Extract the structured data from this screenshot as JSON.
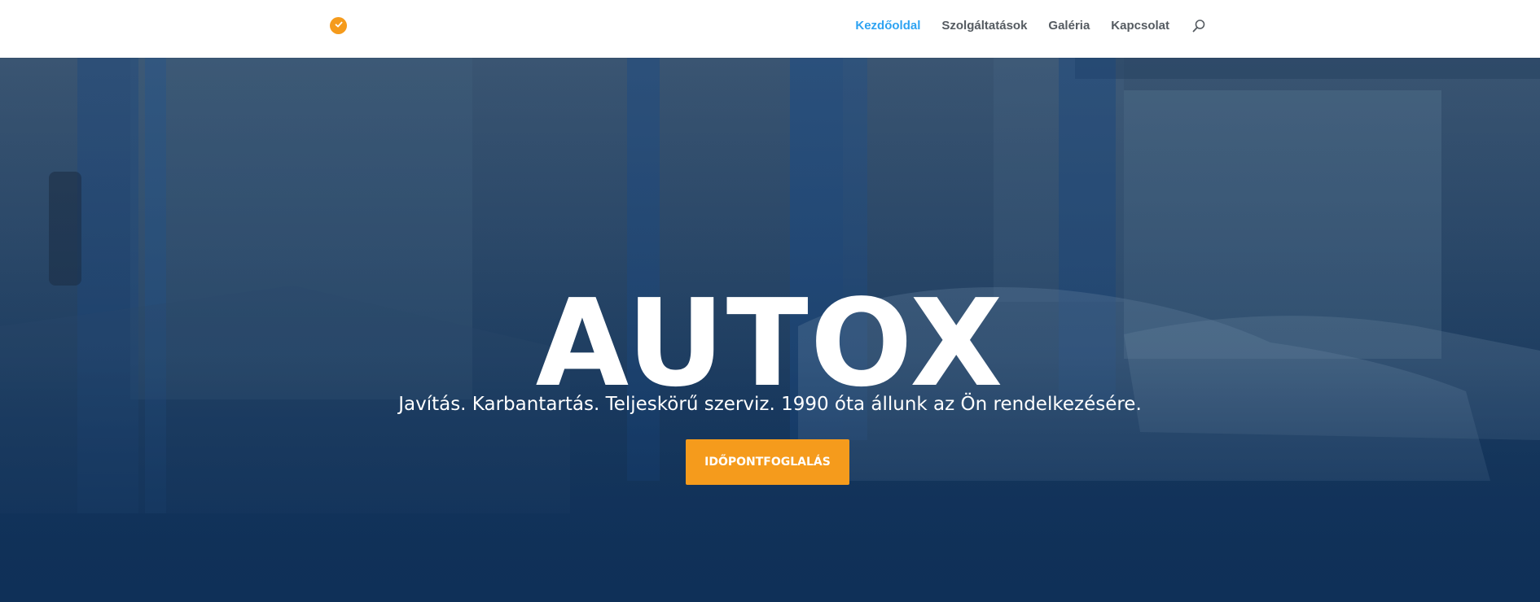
{
  "header": {
    "nav": [
      {
        "label": "Kezdőoldal",
        "active": true
      },
      {
        "label": "Szolgáltatások",
        "active": false
      },
      {
        "label": "Galéria",
        "active": false
      },
      {
        "label": "Kapcsolat",
        "active": false
      }
    ],
    "search_icon": "search-icon",
    "logo_icon": "check-circle-icon"
  },
  "hero": {
    "title": "AUTOX",
    "subtitle": "Javítás. Karbantartás. Teljeskörű szerviz. 1990 óta állunk az Ön rendelkezésére.",
    "cta_label": "IDŐPONTFOGLALÁS"
  },
  "colors": {
    "accent": "#f59b1c",
    "nav_active": "#2ea3f2",
    "nav_text": "#555b61",
    "hero_overlay": "#1c3c60"
  }
}
